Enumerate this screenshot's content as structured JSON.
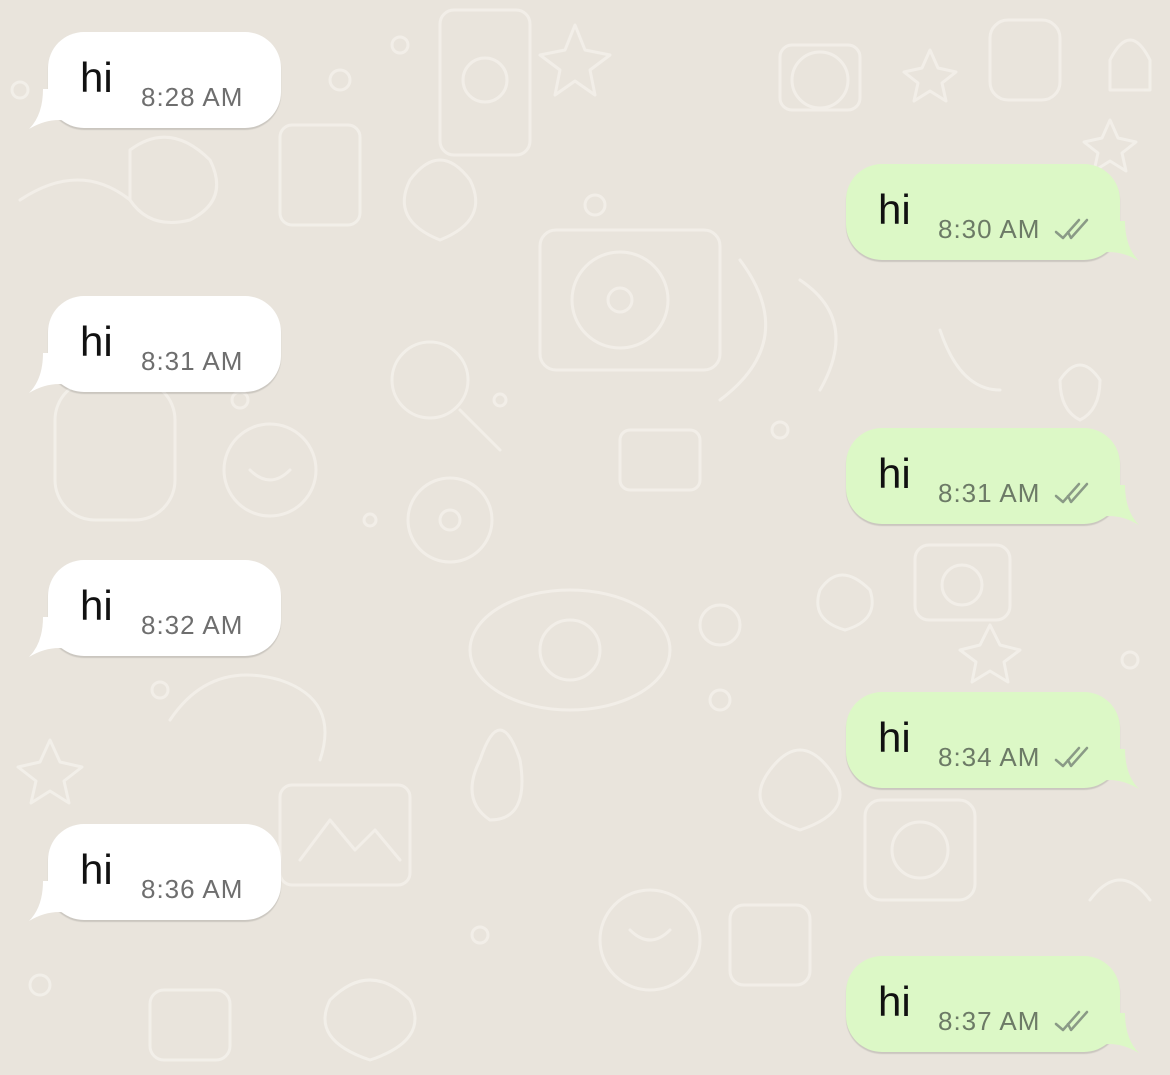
{
  "messages": [
    {
      "direction": "incoming",
      "text": "hi",
      "time": "8:28 AM"
    },
    {
      "direction": "outgoing",
      "text": "hi",
      "time": "8:30 AM",
      "status_icon": "double-check-icon"
    },
    {
      "direction": "incoming",
      "text": "hi",
      "time": "8:31 AM"
    },
    {
      "direction": "outgoing",
      "text": "hi",
      "time": "8:31 AM",
      "status_icon": "double-check-icon"
    },
    {
      "direction": "incoming",
      "text": "hi",
      "time": "8:32 AM"
    },
    {
      "direction": "outgoing",
      "text": "hi",
      "time": "8:34 AM",
      "status_icon": "double-check-icon"
    },
    {
      "direction": "incoming",
      "text": "hi",
      "time": "8:36 AM"
    },
    {
      "direction": "outgoing",
      "text": "hi",
      "time": "8:37 AM",
      "status_icon": "double-check-icon"
    }
  ],
  "colors": {
    "background": "#e9e4dc",
    "incoming_bubble": "#ffffff",
    "outgoing_bubble": "#dcf8c6",
    "tick": "#8a9a86"
  }
}
